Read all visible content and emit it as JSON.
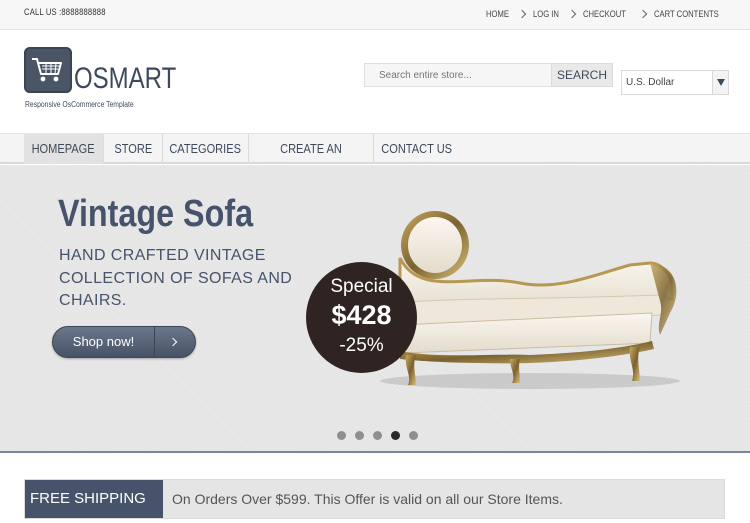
{
  "topbar": {
    "call_us": "CALL US :8888888888",
    "links": [
      "HOME",
      "LOG IN",
      "CHECKOUT",
      "CART CONTENTS"
    ]
  },
  "header": {
    "logo_text": "OSMART",
    "logo_tagline": "Responsive OsCommerce Template",
    "search_placeholder": "Search entire store...",
    "search_button": "SEARCH",
    "currency_selected": "U.S. Dollar"
  },
  "nav": {
    "items": [
      "HOMEPAGE",
      "STORE",
      "CATEGORIES",
      "CREATE AN ACCOUNT",
      "CONTACT US"
    ],
    "active": "HOMEPAGE"
  },
  "slider": {
    "title": "Vintage Sofa",
    "description": "HAND CRAFTED VINTAGE COLLECTION OF SOFAS AND CHAIRS.",
    "button_label": "Shop now!",
    "badge": {
      "line1": "Special",
      "price": "$428",
      "discount": "-25%"
    },
    "dots_total": 5,
    "active_dot": 4
  },
  "shipping": {
    "tag": "FREE SHIPPING",
    "text": "On Orders Over $599. This Offer is valid on all our Store Items."
  },
  "colors": {
    "brand": "#46536a",
    "badge": "#2f2421"
  }
}
